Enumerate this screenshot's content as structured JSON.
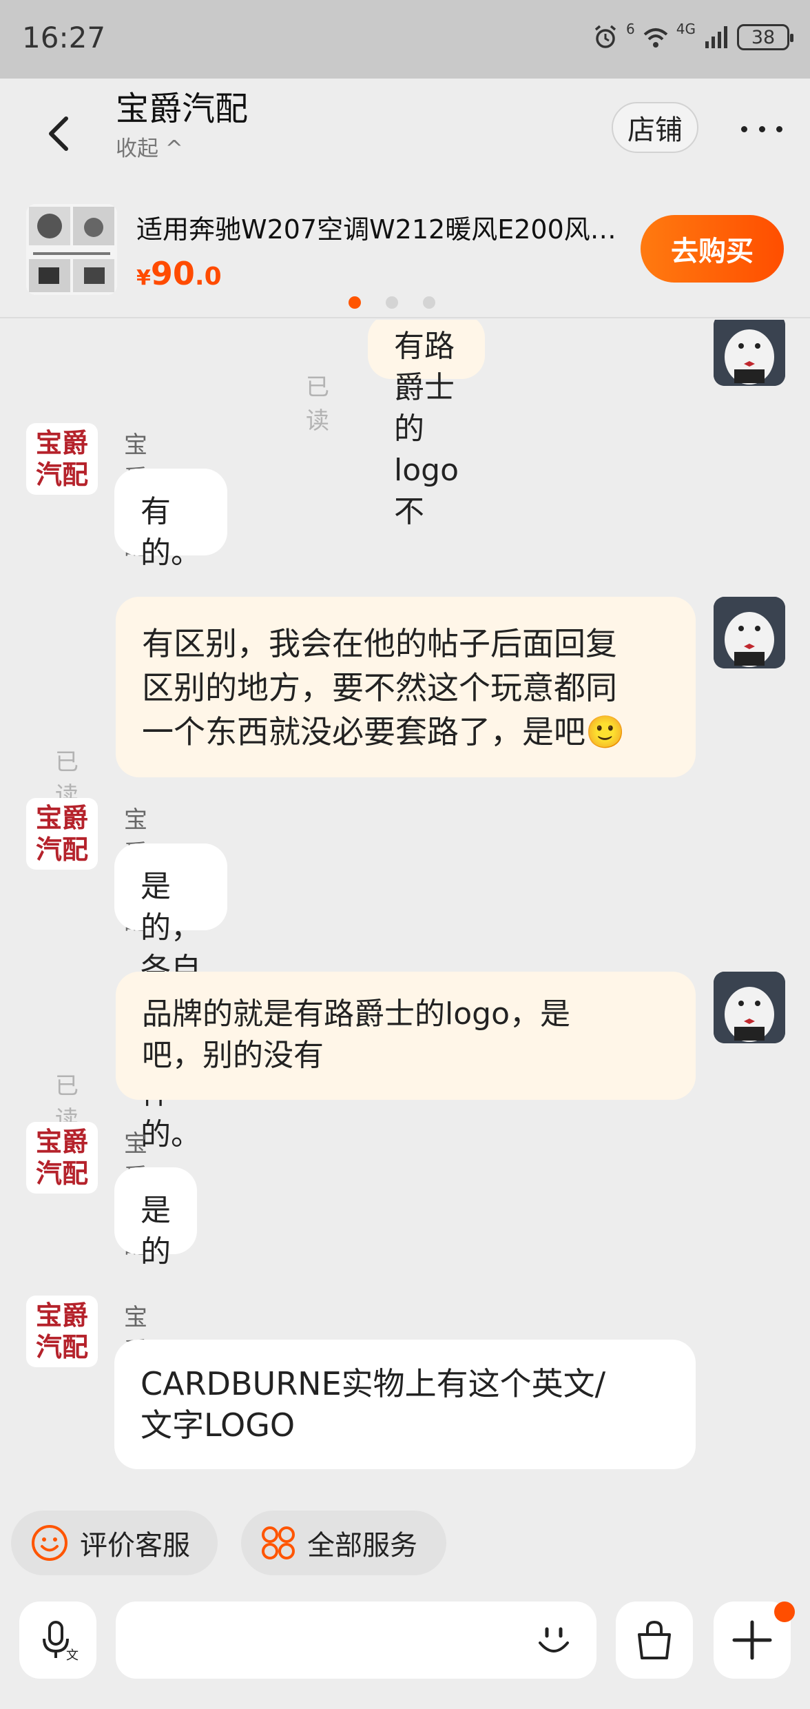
{
  "status_bar": {
    "time": "16:27",
    "network": "4G",
    "wifi_label": "6",
    "battery": "38"
  },
  "header": {
    "shop_name": "宝爵汽配",
    "collapse_label": "收起 ^",
    "shop_button": "店铺"
  },
  "product": {
    "title": "适用奔驰W207空调W212暖风E200风…",
    "currency": "¥",
    "price_int": "90",
    "price_dec": ".0",
    "buy_button": "去购买"
  },
  "shop_avatar": {
    "line1": "宝爵",
    "line2": "汽配"
  },
  "messages": [
    {
      "side": "out",
      "text": "有路爵士的logo不",
      "read": "已读"
    },
    {
      "side": "in",
      "sender": "宝爵汽配",
      "text": "有的。"
    },
    {
      "side": "out",
      "lines": [
        "有区别，我会在他的帖子后面回复",
        "区别的地方，要不然这个玩意都同",
        "一个东西就没必要套路了，是吧🙂"
      ],
      "read": "已读"
    },
    {
      "side": "in",
      "sender": "宝爵汽配",
      "text": "是的，各自不同 不一样的。"
    },
    {
      "side": "out",
      "lines": [
        "品牌的就是有路爵士的logo，是",
        "吧，别的没有"
      ],
      "read": "已读"
    },
    {
      "side": "in",
      "sender": "宝爵汽配",
      "text": "是的"
    },
    {
      "side": "in",
      "sender": "宝爵汽配",
      "lines": [
        "CARDBURNE实物上有这个英文/",
        "文字LOGO"
      ]
    }
  ],
  "quick_actions": {
    "rate": "评价客服",
    "all_services": "全部服务"
  },
  "input": {
    "placeholder": ""
  },
  "colors": {
    "accent": "#ff5500",
    "out_bubble": "#fff6e8",
    "shop_red": "#b5222b"
  }
}
